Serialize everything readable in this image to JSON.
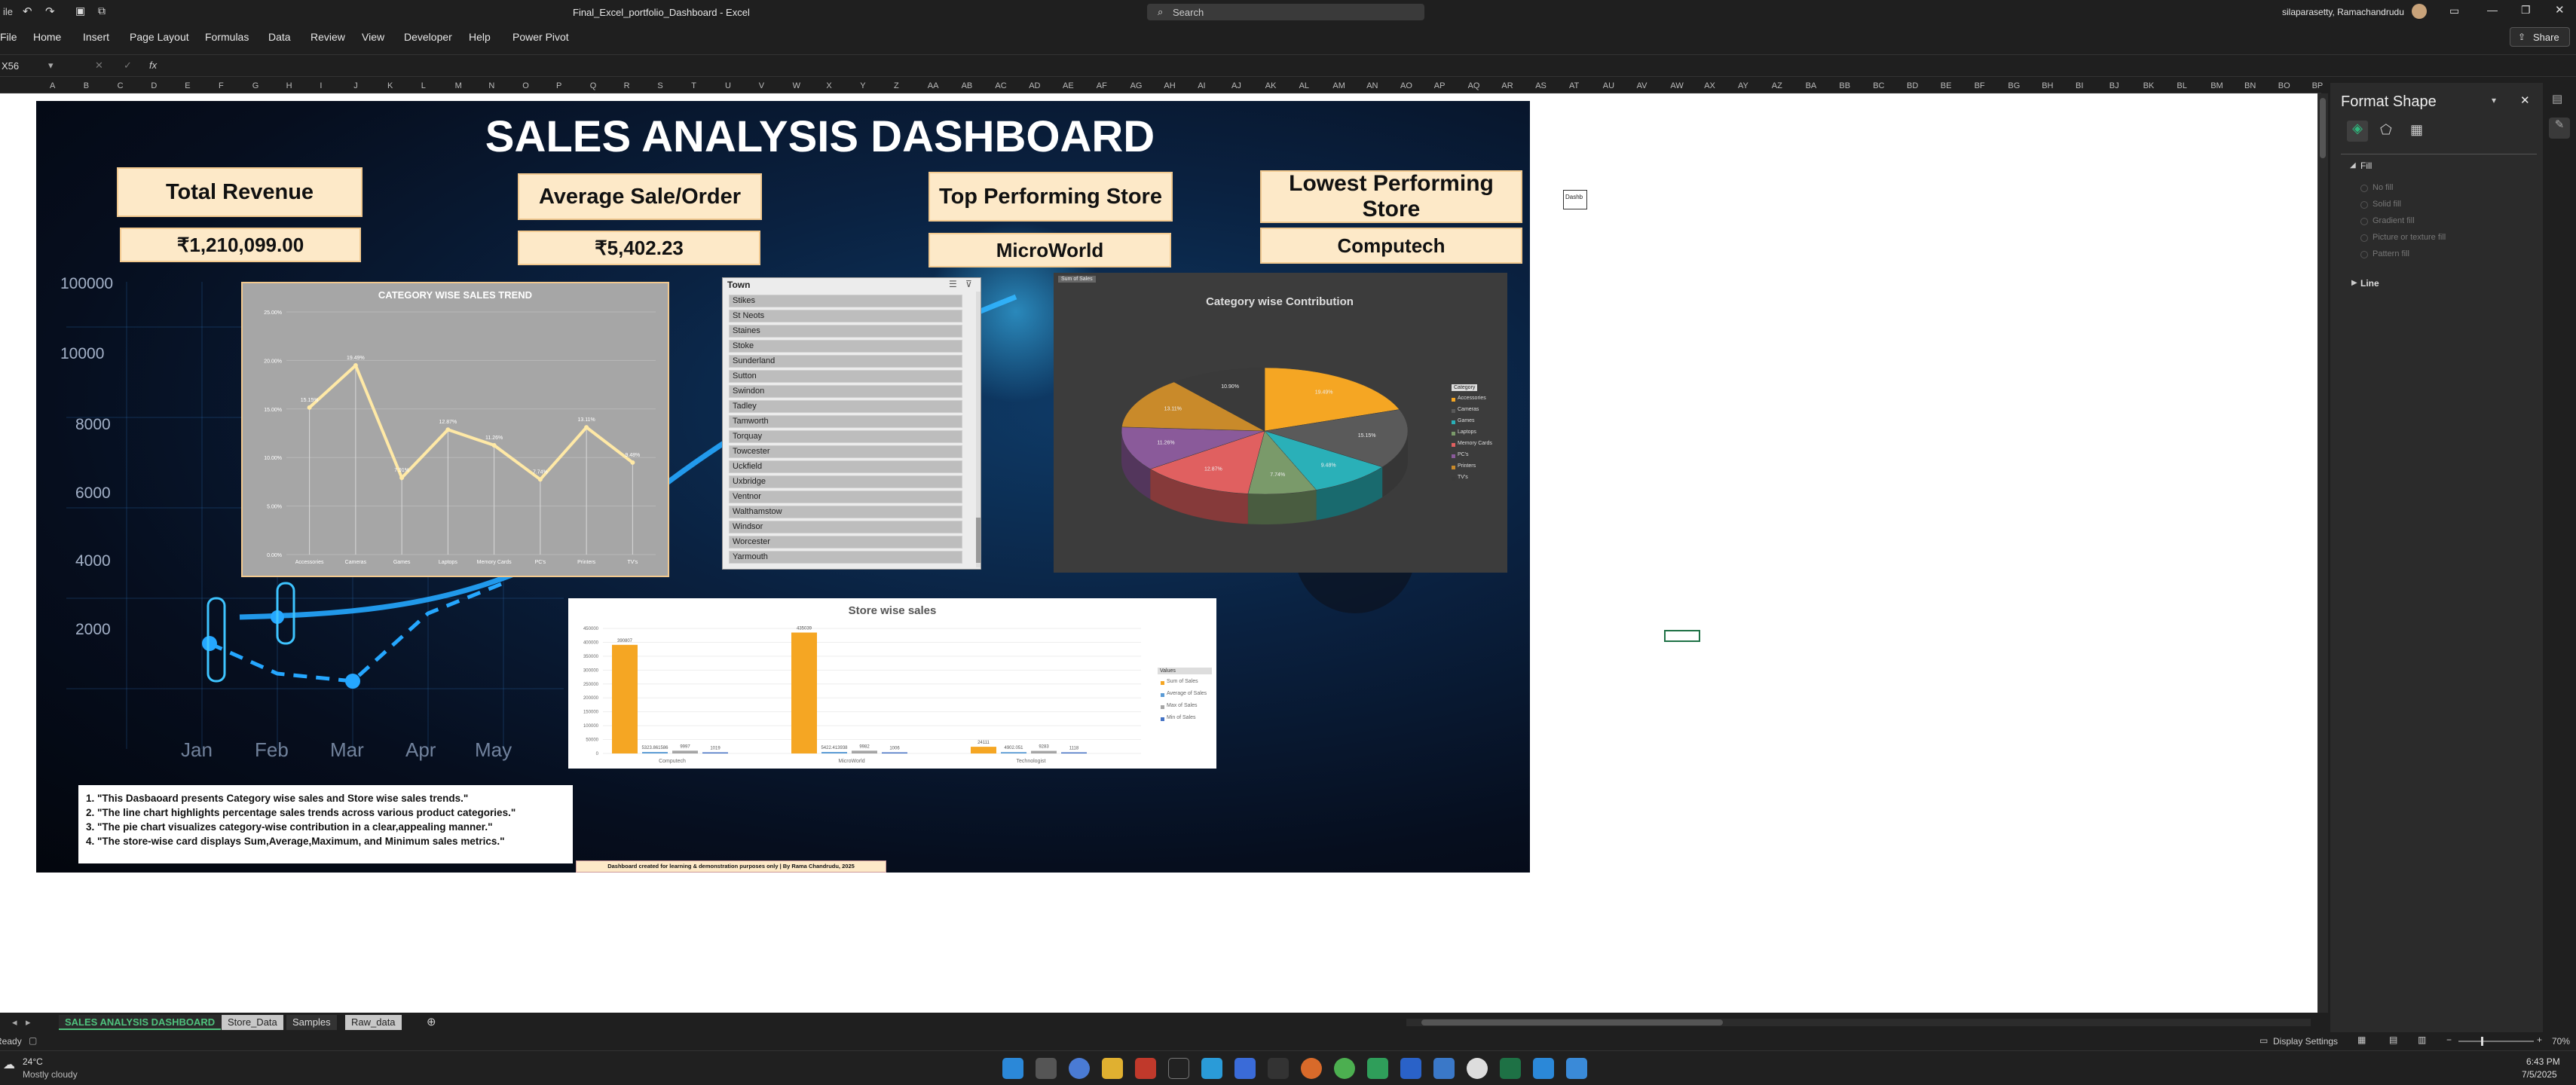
{
  "titlebar": {
    "file_title": "Final_Excel_portfolio_Dashboard - Excel",
    "search_placeholder": "Search",
    "user_name": "silaparasetty, Ramachandrudu"
  },
  "menu": {
    "items": [
      "File",
      "Home",
      "Insert",
      "Page Layout",
      "Formulas",
      "Data",
      "Review",
      "View",
      "Developer",
      "Help",
      "Power Pivot"
    ],
    "share_label": "Share"
  },
  "formula": {
    "name_box": "X56",
    "fx": "fx",
    "value": ""
  },
  "columns": [
    "A",
    "B",
    "C",
    "D",
    "E",
    "F",
    "G",
    "H",
    "I",
    "J",
    "K",
    "L",
    "M",
    "N",
    "O",
    "P",
    "Q",
    "R",
    "S",
    "T",
    "U",
    "V",
    "W",
    "X",
    "Y",
    "Z",
    "AA",
    "AB",
    "AC",
    "AD",
    "AE",
    "AF",
    "AG",
    "AH",
    "AI",
    "AJ",
    "AK",
    "AL",
    "AM",
    "AN",
    "AO",
    "AP",
    "AQ",
    "AR",
    "AS",
    "AT",
    "AU",
    "AV",
    "AW",
    "AX",
    "AY",
    "AZ",
    "BA",
    "BB",
    "BC",
    "BD",
    "BE",
    "BF",
    "BG",
    "BH",
    "BI",
    "BJ",
    "BK",
    "BL",
    "BM",
    "BN",
    "BO",
    "BP"
  ],
  "dashboard": {
    "title": "SALES ANALYSIS DASHBOARD",
    "cards": {
      "total_revenue_label": "Total Revenue",
      "total_revenue_value": "₹1,210,099.00",
      "avg_sale_label": "Average Sale/Order",
      "avg_sale_value": "₹5,402.23",
      "top_store_label": "Top Performing Store",
      "top_store_value": "MicroWorld",
      "lowest_store_label": "Lowest Performing Store",
      "lowest_store_value": "Computech"
    },
    "background_axis": {
      "y": [
        "100000",
        "10000",
        "8000",
        "6000",
        "4000",
        "2000"
      ],
      "x": [
        "Jan",
        "Feb",
        "Mar",
        "Apr",
        "May"
      ]
    },
    "notes": [
      "1. \"This Dasbaoard presents Category wise sales and Store wise sales trends.\"",
      "2. \"The line chart highlights percentage sales trends across various product  categories.\"",
      "3. \"The pie chart visualizes category-wise contribution in a clear,appealing manner.\"",
      "4. \"The store-wise card displays Sum,Average,Maximum, and Minimum sales metrics.\""
    ],
    "credit": "Dashboard created for learning & demonstration purposes only | By Rama Chandrudu, 2025",
    "small_box_label": "Dashb"
  },
  "slicer": {
    "header": "Town",
    "items": [
      "Stikes",
      "St Neots",
      "Staines",
      "Stoke",
      "Sunderland",
      "Sutton",
      "Swindon",
      "Tadley",
      "Tamworth",
      "Torquay",
      "Towcester",
      "Uckfield",
      "Uxbridge",
      "Ventnor",
      "Walthamstow",
      "Windsor",
      "Worcester",
      "Yarmouth"
    ]
  },
  "colors": {
    "accent_orange": "#f5a623",
    "card_fill": "#fde9c8",
    "excel_green": "#1e7145",
    "line_yellow": "#ffe9a6"
  },
  "chart_data": [
    {
      "type": "line",
      "title": "CATEGORY WISE SALES TREND",
      "categories": [
        "Accessories",
        "Cameras",
        "Games",
        "Laptops",
        "Memory Cards",
        "PC's",
        "Printers",
        "TV's"
      ],
      "values": [
        15.15,
        19.49,
        7.91,
        12.87,
        11.26,
        7.74,
        13.11,
        9.48
      ],
      "value_labels": [
        "15.15%",
        "19.49%",
        "7.91%",
        "12.87%",
        "11.26%",
        "7.74%",
        "13.11%",
        "9.48%"
      ],
      "y_ticks": [
        "0.00%",
        "5.00%",
        "10.00%",
        "15.00%",
        "20.00%",
        "25.00%"
      ],
      "ylim": [
        0,
        25
      ]
    },
    {
      "type": "pie",
      "title": "Category wise Contribution",
      "badge": "Sum of Sales",
      "legend_title": "Category",
      "categories": [
        "Accessories",
        "Cameras",
        "Games",
        "Laptops",
        "Memory Cards",
        "PC's",
        "Printers",
        "TV's"
      ],
      "values": [
        19.49,
        15.15,
        9.48,
        7.74,
        12.87,
        11.26,
        13.11,
        10.9
      ],
      "colors": [
        "#f5a623",
        "#5a5a5a",
        "#2ab0b8",
        "#7a9a6a",
        "#e06060",
        "#8a5a9a",
        "#c98a2a",
        "#3a3a3a"
      ]
    },
    {
      "type": "bar",
      "title": "Store wise sales",
      "categories": [
        "Computech",
        "MicroWorld",
        "Technologist"
      ],
      "series": [
        {
          "name": "Sum of Sales",
          "values": [
            390807,
            435039,
            24111
          ]
        },
        {
          "name": "Average of Sales",
          "values": [
            5323.85,
            5422.41,
            4902.05
          ]
        },
        {
          "name": "Max of Sales",
          "values": [
            9997,
            9982,
            9283
          ]
        },
        {
          "name": "Min of Sales",
          "values": [
            1019,
            1006,
            1118
          ]
        }
      ],
      "value_labels": [
        [
          "390807",
          "5323.861586",
          "9997",
          "1019"
        ],
        [
          "435039",
          "5422.413938",
          "9982",
          "1006"
        ],
        [
          "24111",
          "4902.051",
          "9283",
          "1118"
        ]
      ],
      "y_ticks": [
        "0",
        "50000",
        "100000",
        "150000",
        "200000",
        "250000",
        "300000",
        "350000",
        "400000",
        "450000"
      ],
      "legend_title": "Values",
      "ylim": [
        0,
        450000
      ]
    }
  ],
  "format_pane": {
    "title": "Format Shape",
    "fill_section": "Fill",
    "options": [
      "No fill",
      "Solid fill",
      "Gradient fill",
      "Picture or texture fill",
      "Pattern fill"
    ],
    "line_section": "Line"
  },
  "sheet_tabs": [
    "SALES ANALYSIS DASHBOARD",
    "Store_Data",
    "Samples",
    "Raw_data"
  ],
  "status": {
    "ready": "Ready",
    "display_settings": "Display Settings",
    "zoom": "70%"
  },
  "taskbar": {
    "weather_temp": "24°C",
    "weather_desc": "Mostly cloudy",
    "time": "6:43 PM",
    "date": "7/5/2025"
  }
}
